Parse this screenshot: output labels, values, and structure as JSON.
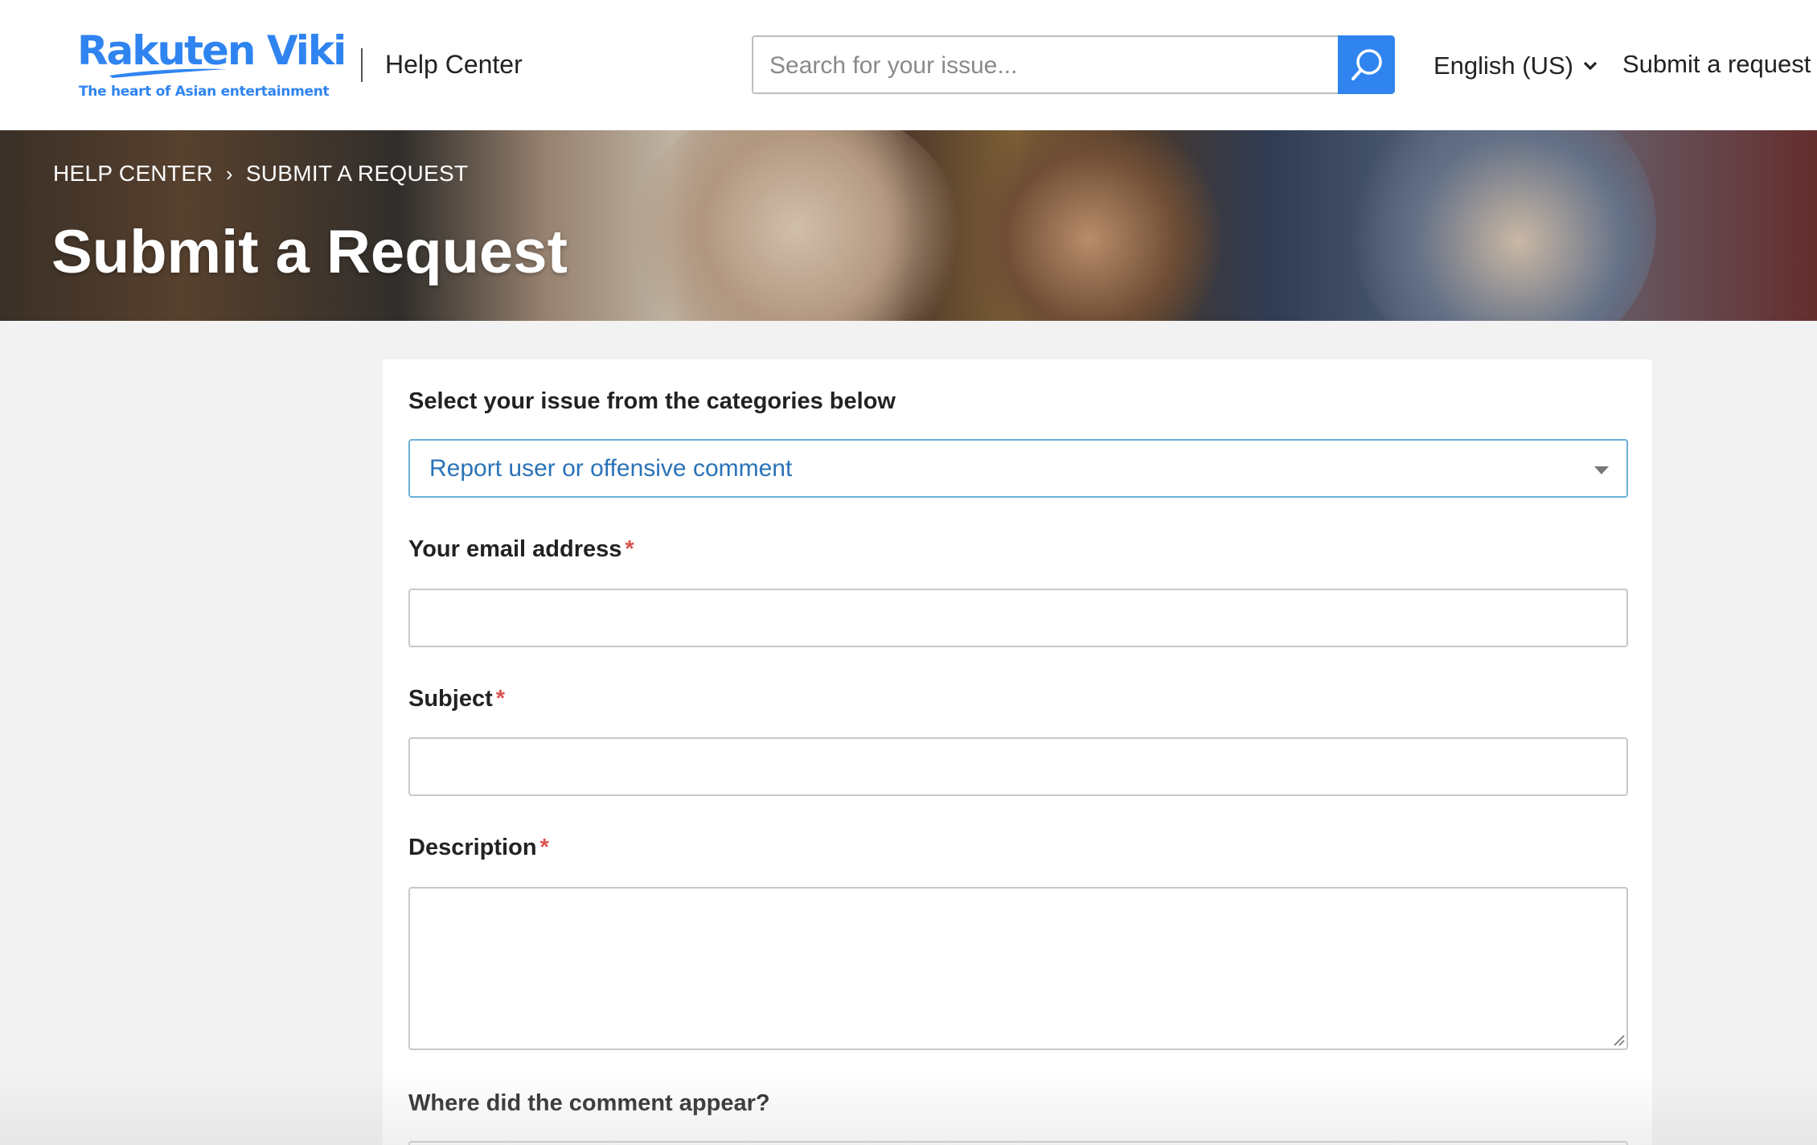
{
  "header": {
    "logo_text": "Rakuten Viki",
    "logo_tagline": "The heart of Asian entertainment",
    "section_title": "Help Center",
    "search_placeholder": "Search for your issue...",
    "language": "English (US)",
    "submit_request_link": "Submit a request"
  },
  "hero": {
    "breadcrumb": [
      "HELP CENTER",
      "SUBMIT A REQUEST"
    ],
    "breadcrumb_separator": "›",
    "title": "Submit a Request"
  },
  "form": {
    "category_label": "Select your issue from the categories below",
    "category_value": "Report user or offensive comment",
    "email_label": "Your email address",
    "email_value": "",
    "subject_label": "Subject",
    "subject_value": "",
    "description_label": "Description",
    "description_value": "",
    "required_marker": "*",
    "comment_location_label": "Where did the comment appear?"
  },
  "colors": {
    "brand_blue": "#2f84f0",
    "link_blue": "#2a73b8",
    "required_red": "#d9534f",
    "select_border": "#6ab0d9"
  },
  "icons": {
    "search": "search-icon",
    "language_dropdown": "chevron-down-icon",
    "select_dropdown": "caret-down-icon",
    "resize": "resize-grip-icon"
  }
}
